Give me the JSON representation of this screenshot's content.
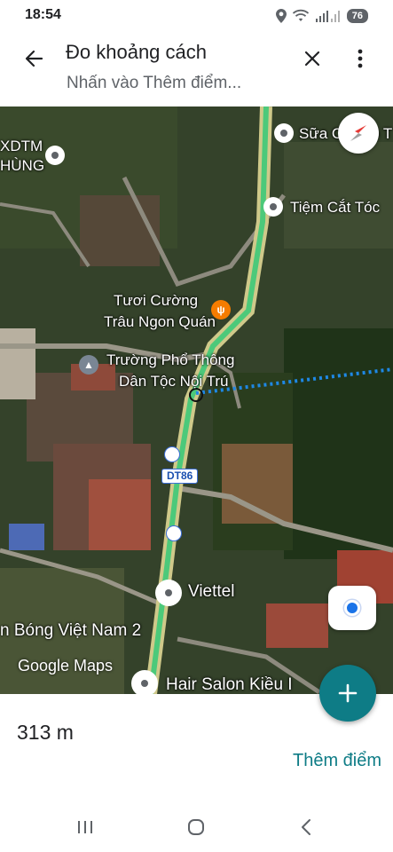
{
  "status_bar": {
    "time": "18:54",
    "battery": "76",
    "icons": [
      "location-icon",
      "wifi-icon",
      "signal-icon",
      "battery-icon"
    ]
  },
  "header": {
    "title": "Đo khoảng cách",
    "subtitle": "Nhấn vào Thêm điểm...",
    "icons": [
      "back-arrow-icon",
      "close-icon",
      "more-vert-icon"
    ]
  },
  "map": {
    "labels": {
      "xdtm": "XDTM",
      "hung": "HÙNG",
      "sua": "Sữa C",
      "sua_tail": "ô T",
      "tiem": "Tiệm Cắt Tóc",
      "tuoi1": "Tươi Cường",
      "tuoi2": "Trâu Ngon Quán",
      "truong1": "Trường Phổ Thông",
      "truong2": "Dân Tộc Nội Trú",
      "road": "DT86",
      "viettel": "Viettel",
      "bong": "n Bóng Việt Nam 2",
      "hair": "Hair Salon Kiều I",
      "google": "Google Maps"
    },
    "colors": {
      "route": "#4cc97a",
      "measure_line": "#1e88e5",
      "accent": "#0e7c86"
    }
  },
  "panel": {
    "distance": "313 m",
    "add_point": "Thêm điểm"
  },
  "nav": {
    "icons": [
      "recents-icon",
      "home-icon",
      "back-icon"
    ]
  }
}
